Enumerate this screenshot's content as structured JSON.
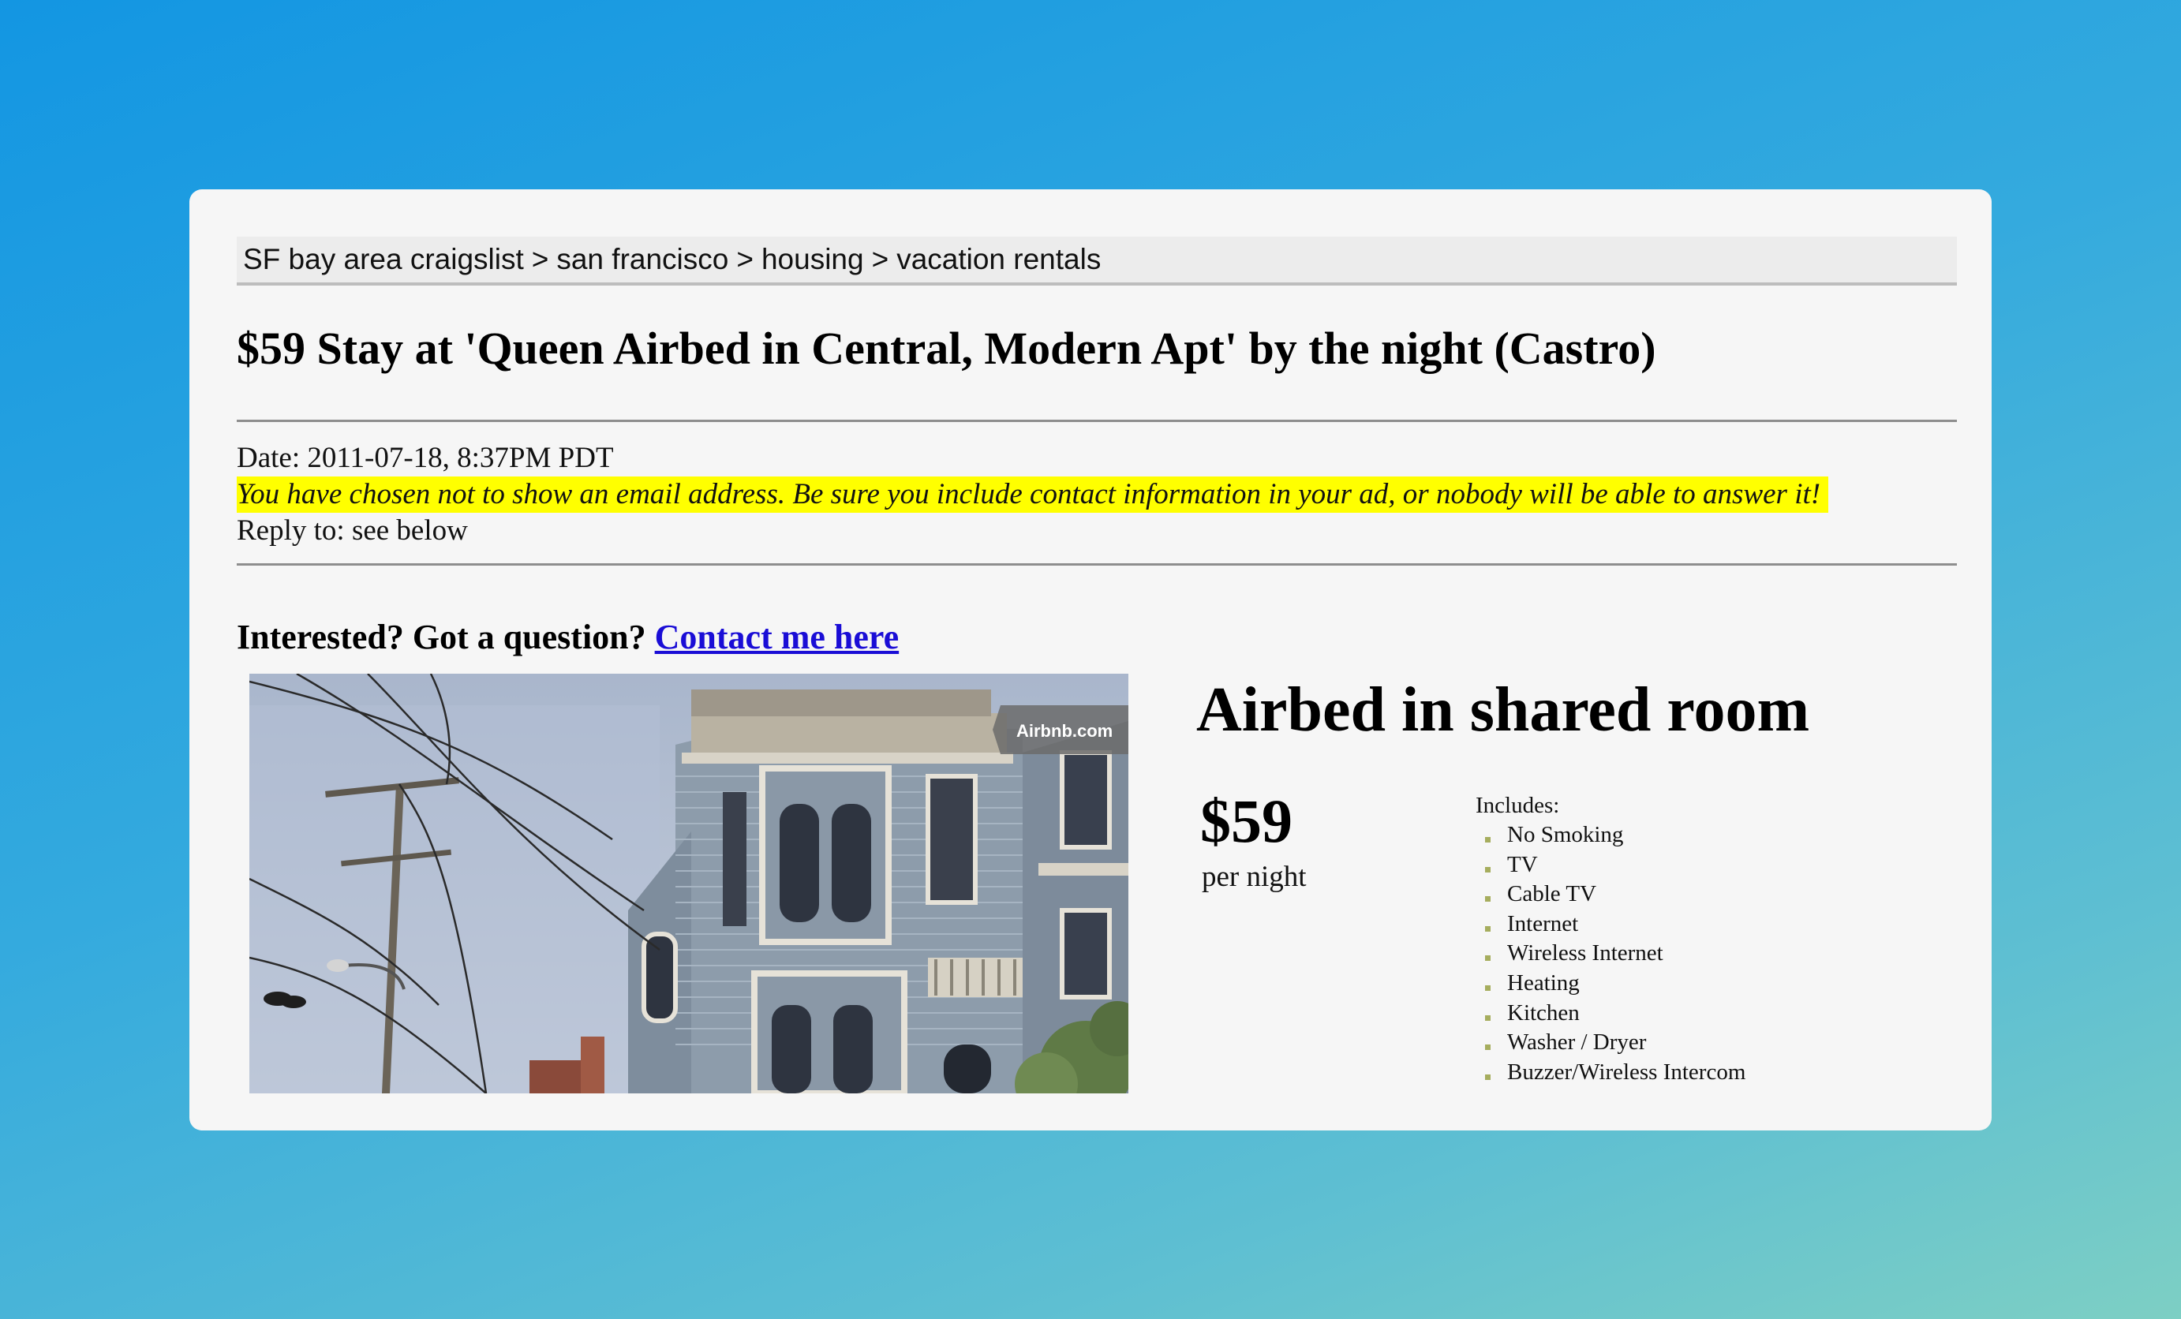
{
  "breadcrumb": {
    "items": [
      "SF bay area craigslist",
      "san francisco",
      "housing",
      "vacation rentals"
    ],
    "separator": ">"
  },
  "post": {
    "title": "$59 Stay at 'Queen Airbed in Central, Modern Apt' by the night (Castro)",
    "date": "Date: 2011-07-18, 8:37PM PDT",
    "warning": "You have chosen not to show an email address. Be sure you include contact information in your ad, or nobody will be able to answer it!",
    "reply_to": "Reply to: see below",
    "interested_text": "Interested? Got a question?",
    "contact_link": "Contact me here"
  },
  "photo": {
    "watermark": "Airbnb.com"
  },
  "listing": {
    "heading": "Airbed in shared room",
    "price": "$59",
    "price_unit": "per night",
    "includes_label": "Includes:",
    "amenities": [
      "No Smoking",
      "TV",
      "Cable TV",
      "Internet",
      "Wireless Internet",
      "Heating",
      "Kitchen",
      "Washer / Dryer",
      "Buzzer/Wireless Intercom"
    ]
  },
  "colors": {
    "link": "#1a0dd6",
    "highlight": "#ffff00",
    "bullet": "#a6ad5e"
  }
}
